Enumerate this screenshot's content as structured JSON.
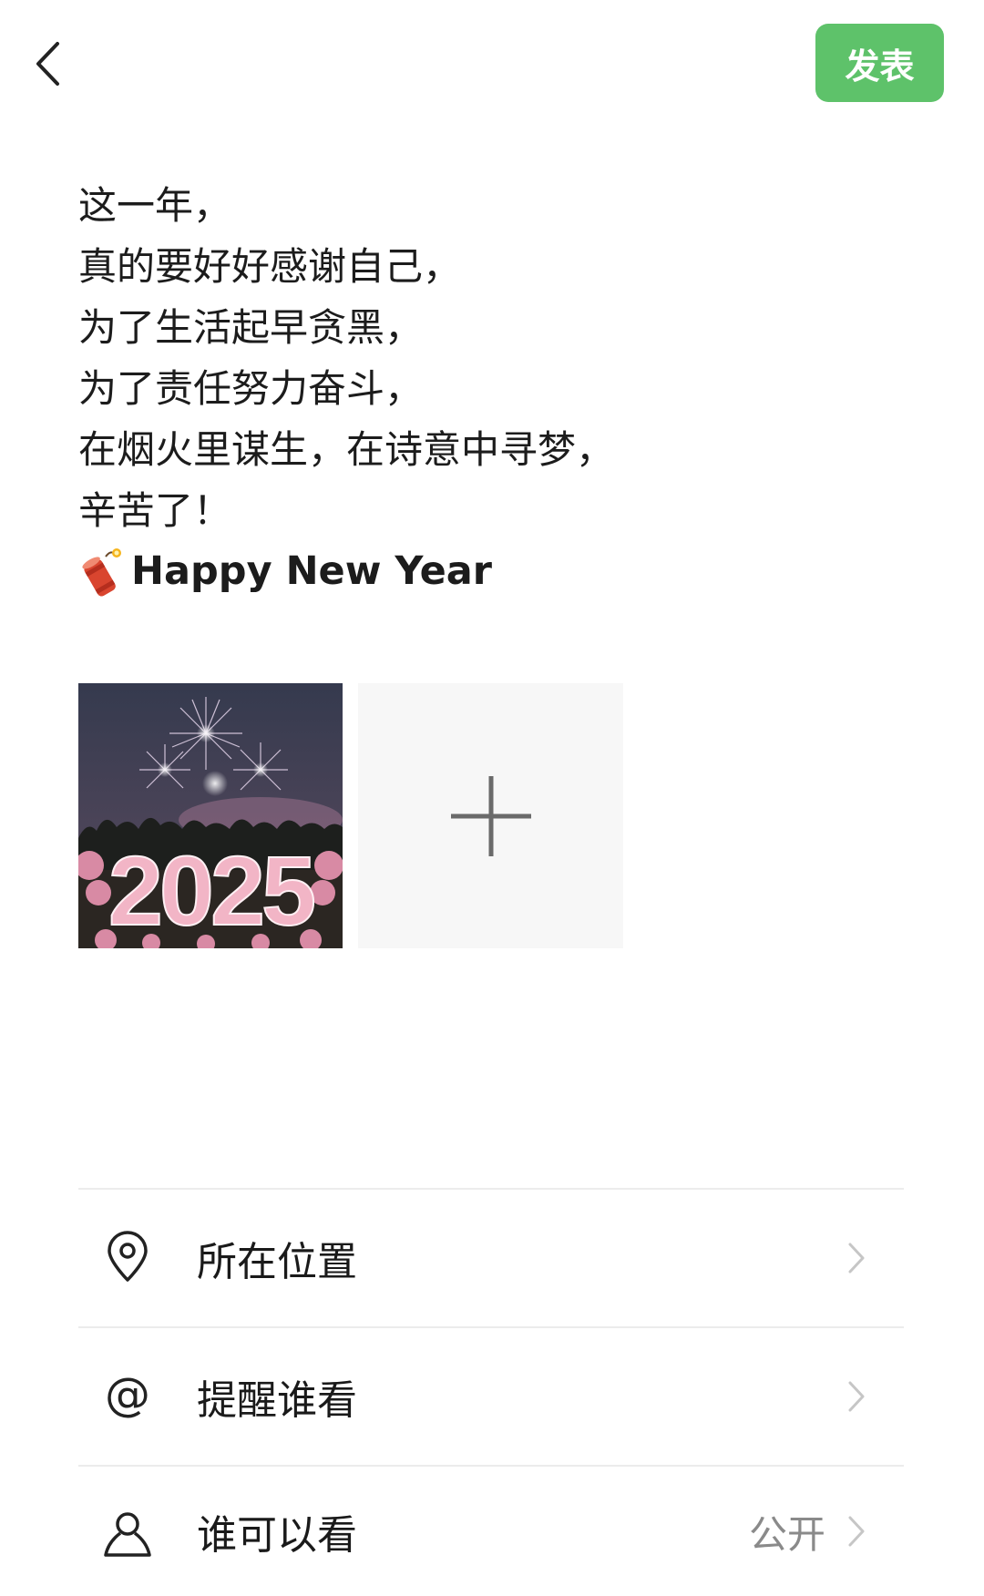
{
  "header": {
    "back_icon": "chevron-left-icon",
    "publish_label": "发表",
    "accent_color": "#5ec26a"
  },
  "post": {
    "lines": [
      "这一年，",
      "真的要好好感谢自己，",
      "为了生活起早贪黑，",
      "为了责任努力奋斗，",
      "在烟火里谋生，在诗意中寻梦，",
      "辛苦了！"
    ],
    "greeting": "Happy New Year",
    "greeting_emoji": "firecracker-icon"
  },
  "media": {
    "photo_text": "2025",
    "add_icon": "plus-icon"
  },
  "options": [
    {
      "icon": "location-pin-icon",
      "label": "所在位置",
      "value": ""
    },
    {
      "icon": "at-sign-icon",
      "label": "提醒谁看",
      "value": ""
    },
    {
      "icon": "person-icon",
      "label": "谁可以看",
      "value": "公开"
    }
  ]
}
